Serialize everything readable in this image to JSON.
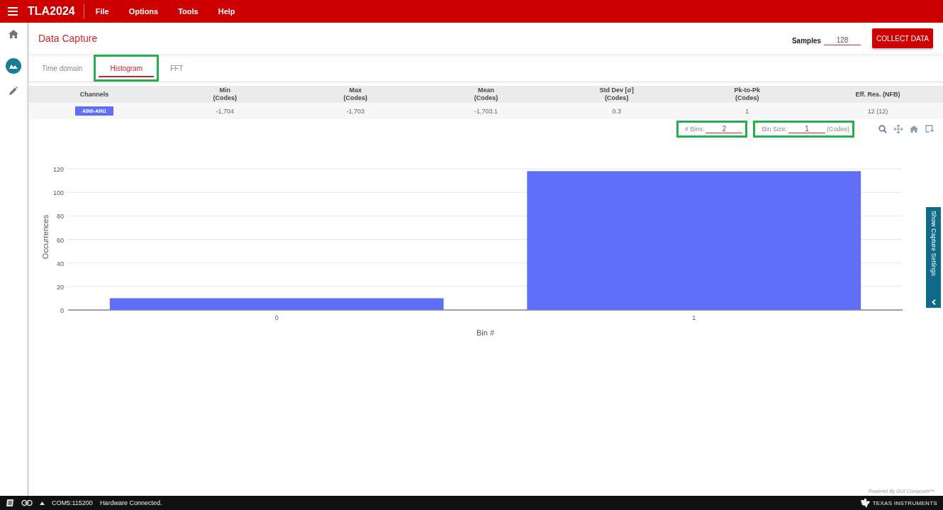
{
  "app": {
    "title": "TLA2024",
    "menu": [
      "File",
      "Options",
      "Tools",
      "Help"
    ]
  },
  "sidebar": [
    {
      "kind": "home",
      "selected": false
    },
    {
      "kind": "chart",
      "selected": true
    },
    {
      "kind": "edit",
      "selected": false
    }
  ],
  "page": {
    "title": "Data Capture",
    "samples_label": "Samples",
    "samples_value": "128",
    "collect_button": "COLLECT DATA"
  },
  "tabs": [
    {
      "label": "Time domain",
      "selected": false,
      "highlighted": false
    },
    {
      "label": "Histogram",
      "selected": true,
      "highlighted": true
    },
    {
      "label": "FFT",
      "selected": false,
      "highlighted": false
    }
  ],
  "stats": {
    "columns": [
      {
        "name": "Channels"
      },
      {
        "name": "Min",
        "unit": "(Codes)"
      },
      {
        "name": "Max",
        "unit": "(Codes)"
      },
      {
        "name": "Mean",
        "unit": "(Codes)"
      },
      {
        "name": "Std Dev [σ]",
        "unit": "(Codes)"
      },
      {
        "name": "Pk-to-Pk",
        "unit": "(Codes)"
      },
      {
        "name": "Eff. Res. (NFB)"
      }
    ],
    "rows": [
      {
        "cells": [
          {
            "kind": "tag",
            "text": "AIN0-AIN1"
          },
          {
            "kind": "text",
            "text": "-1,704"
          },
          {
            "kind": "text",
            "text": "-1,703"
          },
          {
            "kind": "text",
            "text": "-1,703.1"
          },
          {
            "kind": "text",
            "text": "0.3"
          },
          {
            "kind": "text",
            "text": "1"
          },
          {
            "kind": "text",
            "text": "12 (12)"
          }
        ]
      }
    ]
  },
  "histogram_controls": {
    "bins": {
      "label": "# Bins:",
      "value": "2",
      "highlighted": true
    },
    "bin_size": {
      "label": "Bin Size:",
      "value": "1",
      "unit": "(Codes)",
      "highlighted": true
    }
  },
  "chart_data": {
    "type": "bar",
    "xlabel": "Bin #",
    "ylabel": "Occurrences",
    "categories": [
      "0",
      "1"
    ],
    "values": [
      10,
      118
    ],
    "ylim": [
      0,
      120
    ],
    "grid": true,
    "yticks": [
      0,
      20,
      40,
      60,
      80,
      100,
      120
    ]
  },
  "side_panel": {
    "label": "Show Capture Settings"
  },
  "powered_by": "Powered By GUI Composer™",
  "status_bar": {
    "port": "COM5:115200",
    "message": "Hardware Connected.",
    "brand": "TEXAS INSTRUMENTS"
  }
}
